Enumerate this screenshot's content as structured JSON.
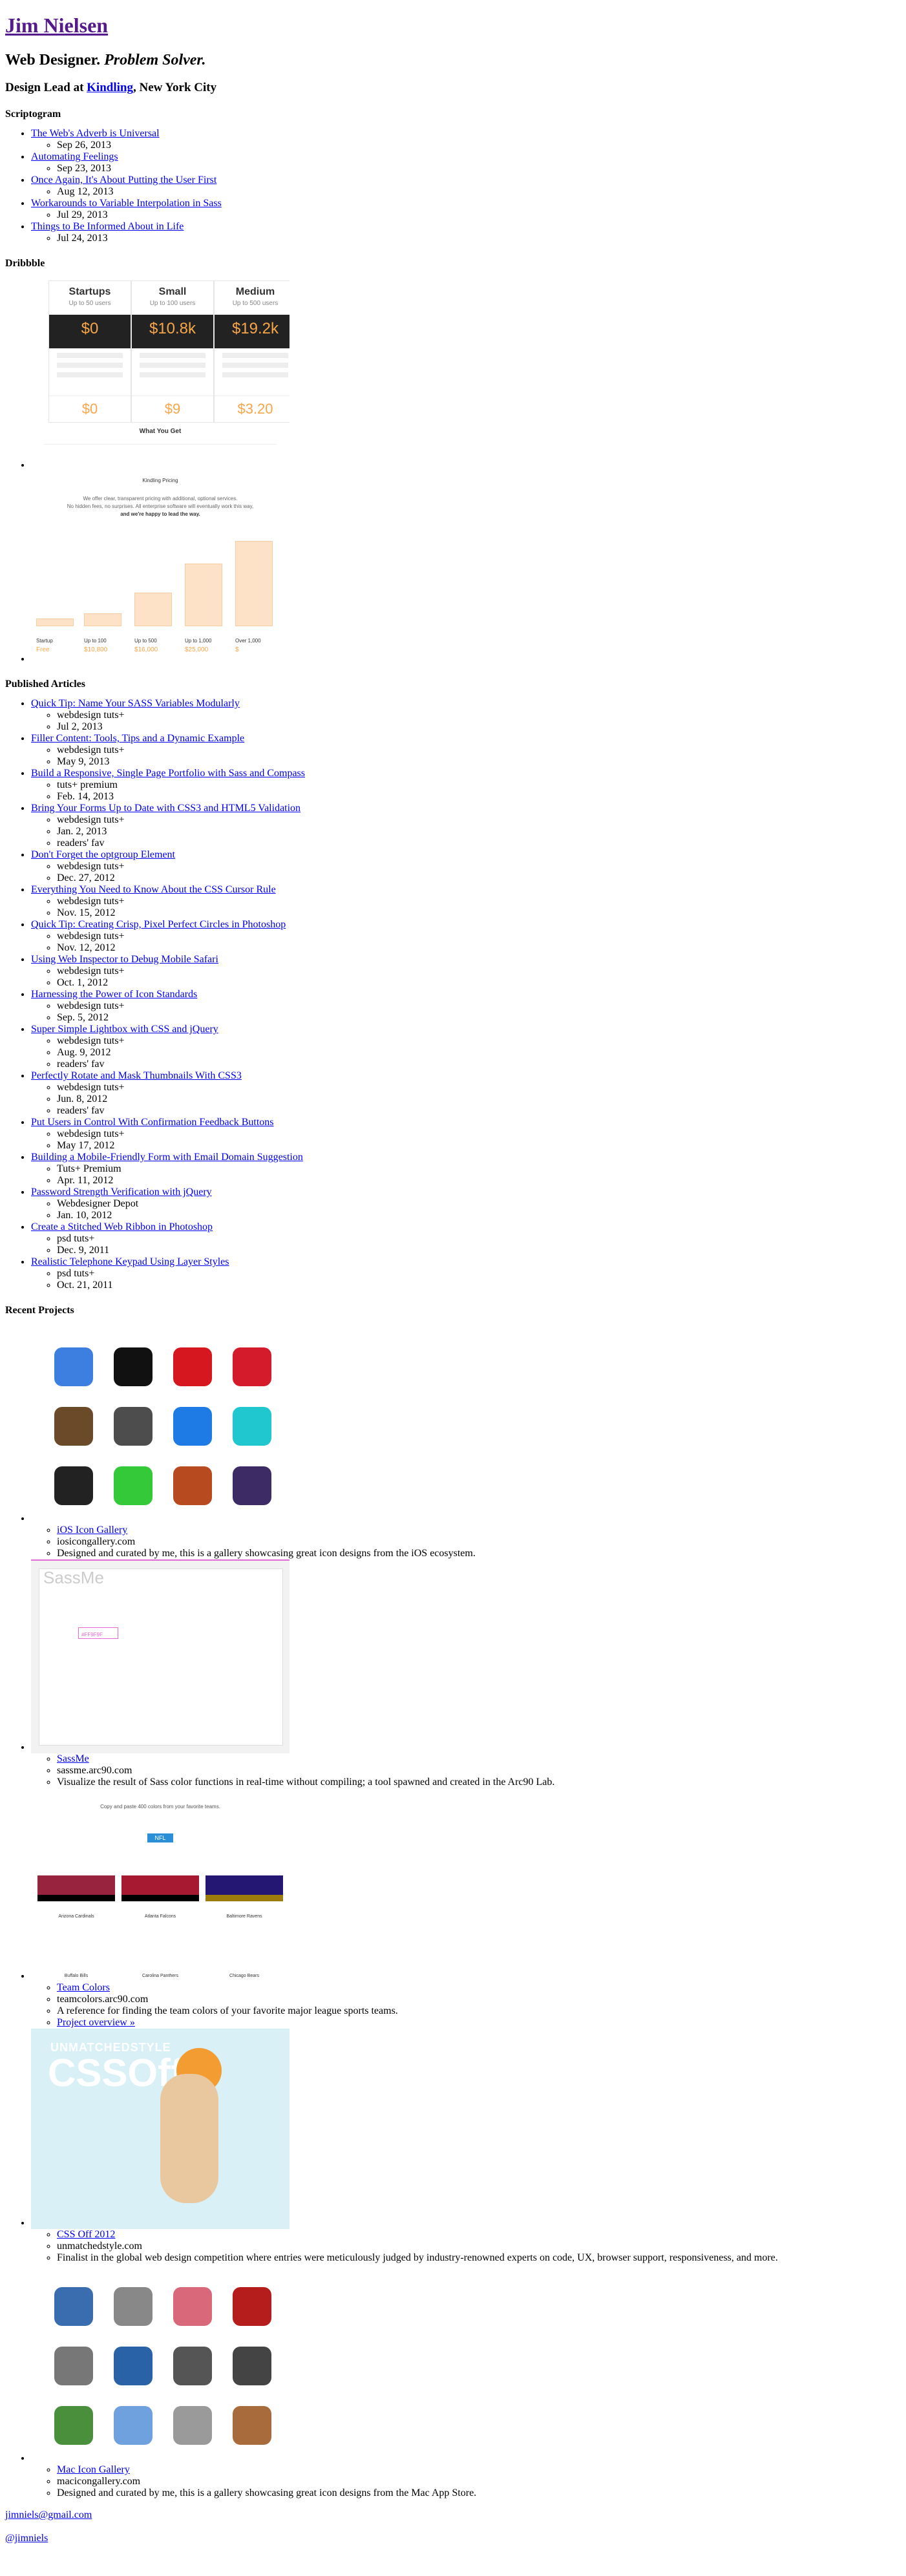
{
  "header": {
    "name": "Jim Nielsen",
    "tagline_plain": "Web Designer. ",
    "tagline_em": "Problem Solver.",
    "role_prefix": "Design Lead at ",
    "role_company": "Kindling",
    "role_suffix": ", New York City"
  },
  "scriptogram": {
    "heading": "Scriptogram",
    "posts": [
      {
        "title": "The Web's Adverb is Universal",
        "date": "Sep 26, 2013"
      },
      {
        "title": "Automating Feelings",
        "date": "Sep 23, 2013"
      },
      {
        "title": "Once Again, It's About Putting the User First",
        "date": "Aug 12, 2013"
      },
      {
        "title": "Workarounds to Variable Interpolation in Sass",
        "date": "Jul 29, 2013"
      },
      {
        "title": "Things to Be Informed About in Life",
        "date": "Jul 24, 2013"
      }
    ]
  },
  "dribbble": {
    "heading": "Dribbble",
    "shot1": {
      "cols": [
        {
          "title": "Startups",
          "sub": "Up to 50 users",
          "price": "$0",
          "foot": "$0"
        },
        {
          "title": "Small",
          "sub": "Up to 100 users",
          "price": "$10.8k",
          "foot": "$9"
        },
        {
          "title": "Medium",
          "sub": "Up to 500 users",
          "price": "$19.2k",
          "foot": "$3.20"
        }
      ],
      "what_you_get": "What You Get"
    },
    "shot2": {
      "title": "Kindling Pricing",
      "line1": "We offer clear, transparent pricing with additional, optional services.",
      "line2": "No hidden fees, no surprises. All enterprise software will eventually work this way,",
      "line3": "and we're happy to lead the way.",
      "bars": [
        {
          "label": "Startup",
          "price": "Free"
        },
        {
          "label": "Up to 100",
          "price": "$10,800"
        },
        {
          "label": "Up to 500",
          "price": "$16,000"
        },
        {
          "label": "Up to 1,000",
          "price": "$25,000"
        },
        {
          "label": "Over 1,000",
          "price": "$"
        }
      ]
    }
  },
  "articles": {
    "heading": "Published Articles",
    "items": [
      {
        "title": "Quick Tip: Name Your SASS Variables Modularly",
        "meta": [
          "webdesign tuts+",
          "Jul 2, 2013"
        ]
      },
      {
        "title": "Filler Content: Tools, Tips and a Dynamic Example",
        "meta": [
          "webdesign tuts+",
          "May 9, 2013"
        ]
      },
      {
        "title": "Build a Responsive, Single Page Portfolio with Sass and Compass",
        "meta": [
          "tuts+ premium",
          "Feb. 14, 2013"
        ]
      },
      {
        "title": "Bring Your Forms Up to Date with CSS3 and HTML5 Validation",
        "meta": [
          "webdesign tuts+",
          "Jan. 2, 2013",
          "readers' fav"
        ]
      },
      {
        "title": "Don't Forget the optgroup Element",
        "meta": [
          "webdesign tuts+",
          "Dec. 27, 2012"
        ]
      },
      {
        "title": "Everything You Need to Know About the CSS Cursor Rule",
        "meta": [
          "webdesign tuts+",
          "Nov. 15, 2012"
        ]
      },
      {
        "title": "Quick Tip: Creating Crisp, Pixel Perfect Circles in Photoshop",
        "meta": [
          "webdesign tuts+",
          "Nov. 12, 2012"
        ]
      },
      {
        "title": "Using Web Inspector to Debug Mobile Safari",
        "meta": [
          "webdesign tuts+",
          "Oct. 1, 2012"
        ]
      },
      {
        "title": "Harnessing the Power of Icon Standards",
        "meta": [
          "webdesign tuts+",
          "Sep. 5, 2012"
        ]
      },
      {
        "title": "Super Simple Lightbox with CSS and jQuery",
        "meta": [
          "webdesign tuts+",
          "Aug. 9, 2012",
          "readers' fav"
        ]
      },
      {
        "title": "Perfectly Rotate and Mask Thumbnails With CSS3",
        "meta": [
          "webdesign tuts+",
          "Jun. 8, 2012",
          "readers' fav"
        ]
      },
      {
        "title": "Put Users in Control With Confirmation Feedback Buttons",
        "meta": [
          "webdesign tuts+",
          "May 17, 2012"
        ]
      },
      {
        "title": "Building a Mobile-Friendly Form with Email Domain Suggestion",
        "meta": [
          "Tuts+ Premium",
          "Apr. 11, 2012"
        ]
      },
      {
        "title": "Password Strength Verification with jQuery",
        "meta": [
          "Webdesigner Depot",
          "Jan. 10, 2012"
        ]
      },
      {
        "title": "Create a Stitched Web Ribbon in Photoshop",
        "meta": [
          "psd tuts+",
          "Dec. 9, 2011"
        ]
      },
      {
        "title": "Realistic Telephone Keypad Using Layer Styles",
        "meta": [
          "psd tuts+",
          "Oct. 21, 2011"
        ]
      }
    ]
  },
  "projects": {
    "heading": "Recent Projects",
    "items": [
      {
        "title": "iOS Icon Gallery",
        "site": "iosicongallery.com",
        "desc": "Designed and curated by me, this is a gallery showcasing great icon designs from the iOS ecosystem."
      },
      {
        "title": "SassMe",
        "site": "sassme.arc90.com",
        "desc": "Visualize the result of Sass color functions in real-time without compiling; a tool spawned and created in the Arc90 Lab."
      },
      {
        "title": "Team Colors",
        "site": "teamcolors.arc90.com",
        "desc": "A reference for finding the team colors of your favorite major league sports teams.",
        "link": "Project overview »"
      },
      {
        "title": "CSS Off 2012",
        "site": "unmatchedstyle.com",
        "desc": "Finalist in the global web design competition where entries were meticulously judged by industry-renowned experts on code, UX, browser support, responsiveness, and more."
      },
      {
        "title": "Mac Icon Gallery",
        "site": "macicongallery.com",
        "desc": "Designed and curated by me, this is a gallery showcasing great icon designs from the Mac App Store."
      }
    ],
    "sassme_logo": "SassMe",
    "sassme_input": "#FF9F9F",
    "teams_header": "Copy and paste 400 colors from your favorite teams.",
    "teams_league": "NFL",
    "teams": [
      "Arizona Cardinals",
      "Atlanta Falcons",
      "Baltimore Ravens",
      "Buffalo Bills",
      "Carolina Panthers",
      "Chicago Bears"
    ],
    "cssoff_line1": "UNMATCHEDSTYLE",
    "cssoff_line2": "CSSOff"
  },
  "contact": {
    "email": "jimniels@gmail.com",
    "twitter": "@jimniels"
  },
  "colors": {
    "ios_icons": [
      "#3d7fe0",
      "#111111",
      "#d7171f",
      "#d41b2c",
      "#6b4a2a",
      "#4d4d4d",
      "#1e7be6",
      "#21c7cf",
      "#222222",
      "#34c938",
      "#b84a1f",
      "#3d2b66"
    ],
    "mac_icons": [
      "#3a6db0",
      "#888888",
      "#d8687a",
      "#b51d1d",
      "#777777",
      "#2a62a8",
      "#555555",
      "#444444",
      "#4a8f3b",
      "#6fa1de",
      "#9a9a9a",
      "#a86b3c"
    ]
  }
}
